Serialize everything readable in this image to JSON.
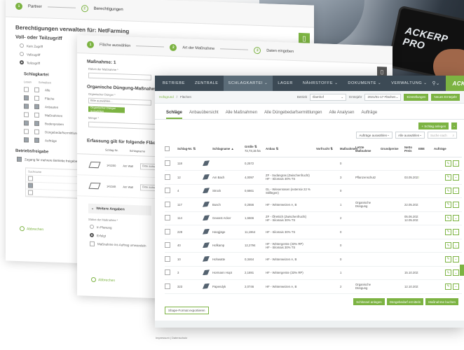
{
  "photo": {
    "tablet_brand": "ACKERP\nPRO"
  },
  "back_window": {
    "steps": [
      {
        "num": "1",
        "label": "Partner"
      },
      {
        "num": "2",
        "label": "Berechtigungen"
      }
    ],
    "title": "Berechtigungen verwalten für: NetFarming",
    "access_heading": "Voll- oder Teilzugriff",
    "access_options": [
      "Kein Zugriff",
      "Vollzugriff",
      "Teilzugriff"
    ],
    "card_heading": "Schlagkartei",
    "perm_headers": [
      "Lesen",
      "Schreiben"
    ],
    "perm_rows": [
      "Alle",
      "Fläche",
      "Anbauten",
      "Maßnahmen",
      "Bodenproben",
      "Düngebedarfsermittlungen",
      "Aufträge"
    ],
    "release_heading": "Betriebsfreigabe",
    "release_text": "Zugang für mehrere Betriebe freigeben",
    "small_table_header": "Suchname",
    "abort": "Abbrechen"
  },
  "mid_window": {
    "steps": [
      {
        "num": "1",
        "label": "Fläche auswählen"
      },
      {
        "num": "2",
        "label": "Art der Maßnahme"
      },
      {
        "num": "3",
        "label": "Daten eingeben"
      }
    ],
    "measure": "Maßnahme: 1",
    "date_label": "Datum der Maßnahme *",
    "section": "Organische Düngung-Maßnahme",
    "fert_label": "Organischer Dünger *",
    "fert_placeholder": "Bitte auswählen...",
    "add_btn": "Organischer Dünger auswählen",
    "amount_label": "Menge *",
    "amount_unit": "m³/ha",
    "area_heading": "Erfassung gilt für folgende Flächen:",
    "area_cols": [
      "Schlag-Nr.",
      "Schlagname",
      "Anbau"
    ],
    "area_rows": [
      {
        "nr": "142200",
        "name": "Am Wall",
        "dd": "Bitte ausw."
      },
      {
        "nr": "142348",
        "name": "Am Wall",
        "dd": "Bitte ausw."
      }
    ],
    "further": "Weitere Angaben",
    "status_label": "Status der Maßnahme *",
    "status_options": [
      "In Planung",
      "Erfolgt",
      "Maßnahme ins Auftrag umwandeln"
    ],
    "abort": "Abbrechen"
  },
  "front": {
    "nav": [
      "BETRIEBE",
      "ZENTRALE",
      "SCHLAGKARTEI",
      "LAGER",
      "NÄHRSTOFFE",
      "DOKUMENTE",
      "VERWALTUNG"
    ],
    "nav_active": 2,
    "brand": "ACKERPROFI",
    "breadcrumb": [
      "Hofsgrund",
      "Flächen"
    ],
    "betrieb_label": "Betrieb",
    "betrieb_value": "Illamhof",
    "ernte_label": "Erntejahr",
    "ernte_value": "2021/01-17 Flächen",
    "btn_einstellungen": "Einstellungen",
    "btn_neues": "Neues Erntejahr",
    "tabs": [
      "Schläge",
      "Anbauübersicht",
      "Alle Maßnahmen",
      "Alle Düngebedarfsermittlungen",
      "Alle Analysen",
      "Aufträge"
    ],
    "active_tab": 0,
    "add_field_btn": "+ Schlag anlegen",
    "filter1": "Aufträge auswählen",
    "filter2": "Alle auswählen",
    "search_placeholder": "Suche nach",
    "columns": [
      "Schlag-Nr.",
      "Schlagname",
      "Größe",
      "Anbau",
      "Vorfrucht",
      "Maßnahmen",
      "Letzte Maßnahme",
      "Grundpreise",
      "Netto Preis",
      "EBE",
      "Aufträge"
    ],
    "size_total": "72,73,15 ha",
    "rows": [
      {
        "nr": "118",
        "name": "",
        "size": "0,2572",
        "anbau": "",
        "mn": "0",
        "last": "",
        "date": "",
        "flag": ""
      },
      {
        "nr": "12",
        "name": "Am Bach",
        "size": "4,0097",
        "anbau": "ZF - Sudangras (Zwischenfrucht)\nHF - Silomais 30% TS",
        "mn": "3",
        "last": "Pflanzenschutz",
        "date": "03.05.2021",
        "flag": "!"
      },
      {
        "nr": "4",
        "name": "Strock",
        "size": "0,6661",
        "anbau": "GL - Wiesenrasen (extensiv 22 %\nStilllegen)",
        "mn": "0",
        "last": "",
        "date": "",
        "flag": ""
      },
      {
        "nr": "117",
        "name": "Busch",
        "size": "0,2556",
        "anbau": "HF - Winterweizen A, B",
        "mn": "1",
        "last": "Organische Düngung",
        "date": "22.05.2021",
        "flag": ""
      },
      {
        "nr": "114",
        "name": "Gewest Acker",
        "size": "1,6666",
        "anbau": "ZF - Ölrettich (Zwischenfrucht)\nHF - Silomais 30% TS",
        "mn": "2",
        "last": "",
        "date": "05.06.2021\n12.05.2021",
        "flag": ""
      },
      {
        "nr": "229",
        "name": "Hangjäge",
        "size": "11,1964",
        "anbau": "HF - Silomais 30% TS",
        "mn": "0",
        "last": "",
        "date": "",
        "flag": ""
      },
      {
        "nr": "40",
        "name": "Hofkamp",
        "size": "12,2794",
        "anbau": "HF - Wintergerste (33% RP)\nHF - Silomais 30% TS",
        "mn": "0",
        "last": "",
        "date": "",
        "flag": ""
      },
      {
        "nr": "10",
        "name": "Hohwatte",
        "size": "0,3464",
        "anbau": "HF - Winterweizen A, B",
        "mn": "0",
        "last": "",
        "date": "",
        "flag": ""
      },
      {
        "nr": "3",
        "name": "Hormann Hopt",
        "size": "2,1691",
        "anbau": "HF - Wintergerste (33% RP)",
        "mn": "1",
        "last": "",
        "date": "15.10.2021",
        "flag": ""
      },
      {
        "nr": "323",
        "name": "Papendyk",
        "size": "2,0746",
        "anbau": "HF - Winterweizen A, B",
        "mn": "2",
        "last": "Organische Düngung",
        "date": "12.10.2021",
        "flag": ""
      }
    ],
    "shape_export": "Shape-Format exportieren",
    "bottom_actions": [
      "Schlüssel anlegen",
      "Düngebedarf ermitteln",
      "Maßnahme buchen"
    ],
    "footer_crumb": "Impressum  |  Datenschutz"
  },
  "colors": {
    "accent": "#7cb342",
    "nav": "#3c4a55"
  }
}
